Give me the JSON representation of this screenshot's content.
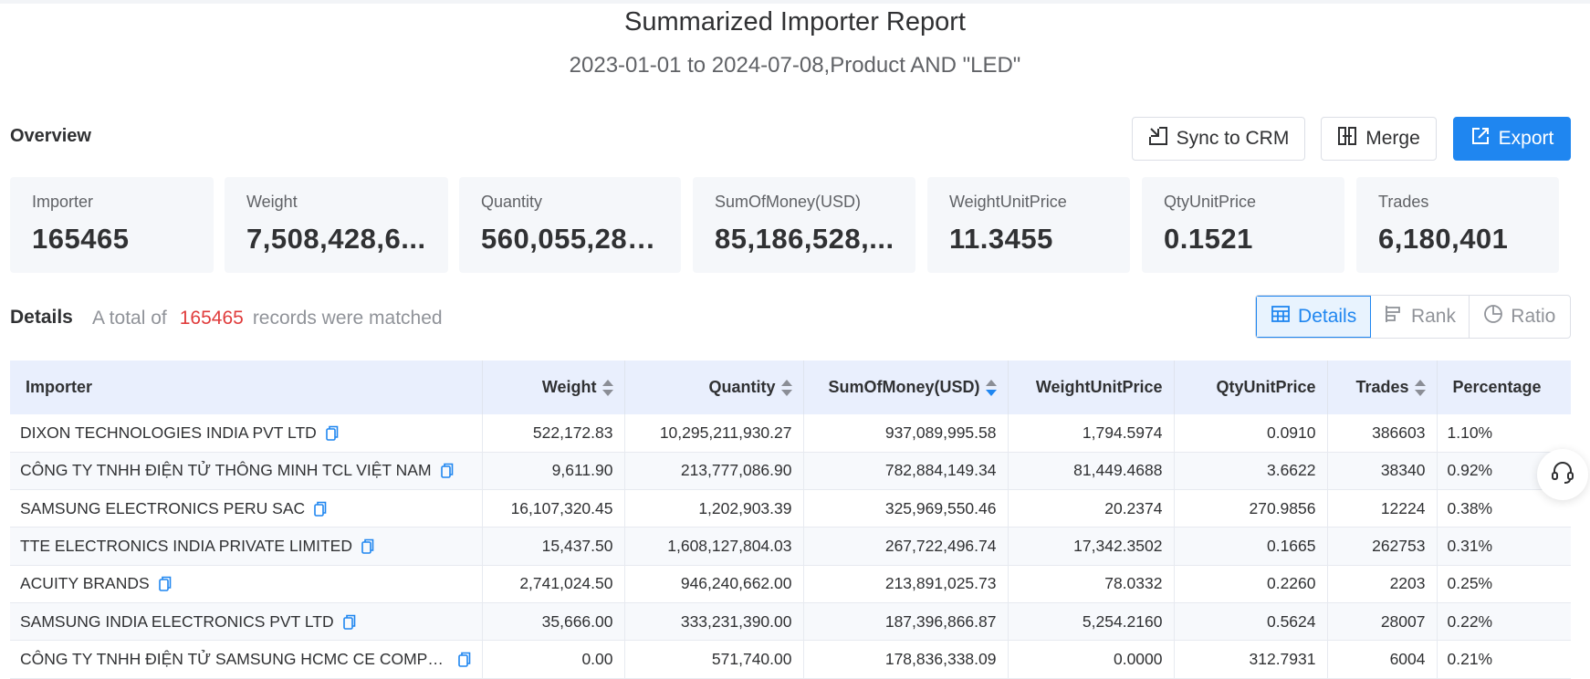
{
  "report": {
    "title": "Summarized Importer Report",
    "subtitle": "2023-01-01 to 2024-07-08,Product AND \"LED\""
  },
  "overview": {
    "label": "Overview",
    "buttons": {
      "sync": "Sync to CRM",
      "merge": "Merge",
      "export": "Export"
    },
    "cards": [
      {
        "label": "Importer",
        "value": "165465"
      },
      {
        "label": "Weight",
        "value": "7,508,428,6..."
      },
      {
        "label": "Quantity",
        "value": "560,055,289..."
      },
      {
        "label": "SumOfMoney(USD)",
        "value": "85,186,528,..."
      },
      {
        "label": "WeightUnitPrice",
        "value": "11.3455"
      },
      {
        "label": "QtyUnitPrice",
        "value": "0.1521"
      },
      {
        "label": "Trades",
        "value": "6,180,401"
      }
    ]
  },
  "details": {
    "label": "Details",
    "records_prefix": "A total of",
    "records_count": "165465",
    "records_suffix": "records were matched",
    "views": {
      "details": "Details",
      "rank": "Rank",
      "ratio": "Ratio"
    },
    "active_view": "Details"
  },
  "table": {
    "columns": [
      "Importer",
      "Weight",
      "Quantity",
      "SumOfMoney(USD)",
      "WeightUnitPrice",
      "QtyUnitPrice",
      "Trades",
      "Percentage"
    ],
    "sorted_column": "SumOfMoney(USD)",
    "sort_direction": "descending",
    "rows": [
      [
        "DIXON TECHNOLOGIES INDIA PVT LTD",
        "522,172.83",
        "10,295,211,930.27",
        "937,089,995.58",
        "1,794.5974",
        "0.0910",
        "386603",
        "1.10%"
      ],
      [
        "CÔNG TY TNHH ĐIỆN TỬ THÔNG MINH TCL VIỆT NAM",
        "9,611.90",
        "213,777,086.90",
        "782,884,149.34",
        "81,449.4688",
        "3.6622",
        "38340",
        "0.92%"
      ],
      [
        "SAMSUNG ELECTRONICS PERU SAC",
        "16,107,320.45",
        "1,202,903.39",
        "325,969,550.46",
        "20.2374",
        "270.9856",
        "12224",
        "0.38%"
      ],
      [
        "TTE ELECTRONICS INDIA PRIVATE LIMITED",
        "15,437.50",
        "1,608,127,804.03",
        "267,722,496.74",
        "17,342.3502",
        "0.1665",
        "262753",
        "0.31%"
      ],
      [
        "ACUITY BRANDS",
        "2,741,024.50",
        "946,240,662.00",
        "213,891,025.73",
        "78.0332",
        "0.2260",
        "2203",
        "0.25%"
      ],
      [
        "SAMSUNG INDIA ELECTRONICS PVT LTD",
        "35,666.00",
        "333,231,390.00",
        "187,396,866.87",
        "5,254.2160",
        "0.5624",
        "28007",
        "0.22%"
      ],
      [
        "CÔNG TY TNHH ĐIỆN TỬ SAMSUNG HCMC CE COMPLE...",
        "0.00",
        "571,740.00",
        "178,836,338.09",
        "0.0000",
        "312.7931",
        "6004",
        "0.21%"
      ]
    ]
  },
  "colors": {
    "accent": "#1f86f0",
    "count_red": "#e03c3c",
    "header_bg": "#e9effd",
    "card_bg": "#f5f7fa"
  },
  "icons": {
    "sync": "sync-crm-icon",
    "merge": "merge-icon",
    "export": "export-icon",
    "details": "table-grid-icon",
    "rank": "rank-bars-icon",
    "ratio": "pie-icon",
    "copy": "copy-icon",
    "support": "headset-icon"
  }
}
